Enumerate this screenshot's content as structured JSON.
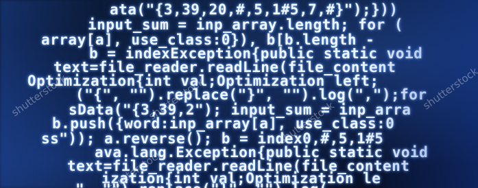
{
  "code_lines": [
    "ata(\"{3,39,20,#,5,1#5,7,#}\");}))",
    "input_sum = inp_array.length; for (",
    "array[a], use_class:0}), b[b.length -",
    "b = indexException{public static void",
    "text=file_reader.readLine(file_content",
    "Optimization{int val;Optimization left;",
    "(\"{\", \"\").replace(\"}\", \"\").log(\",\");for",
    "sData(\"{3,39,2\"); input_sum = inp_arra",
    "b.push({word:inp_array[a], use_class:0",
    "ss\")); a.reverse(); b = index0,#,5,1#5",
    "ava.lang.Exception{public static void",
    "text=file_reader.readLine(file_content",
    "ization{int val;Optimization le",
    "\", \"\").replace(\"}\", \"\").log("
  ],
  "watermarks": [
    "shutterstock",
    "shutterstock",
    "shutterstock",
    "shutterstock",
    "shutterstock"
  ],
  "colors": {
    "background": "#0a1426",
    "code_text": "#eef6ff",
    "keyword": "#b9e23a",
    "glow": "#4fa8ff"
  }
}
